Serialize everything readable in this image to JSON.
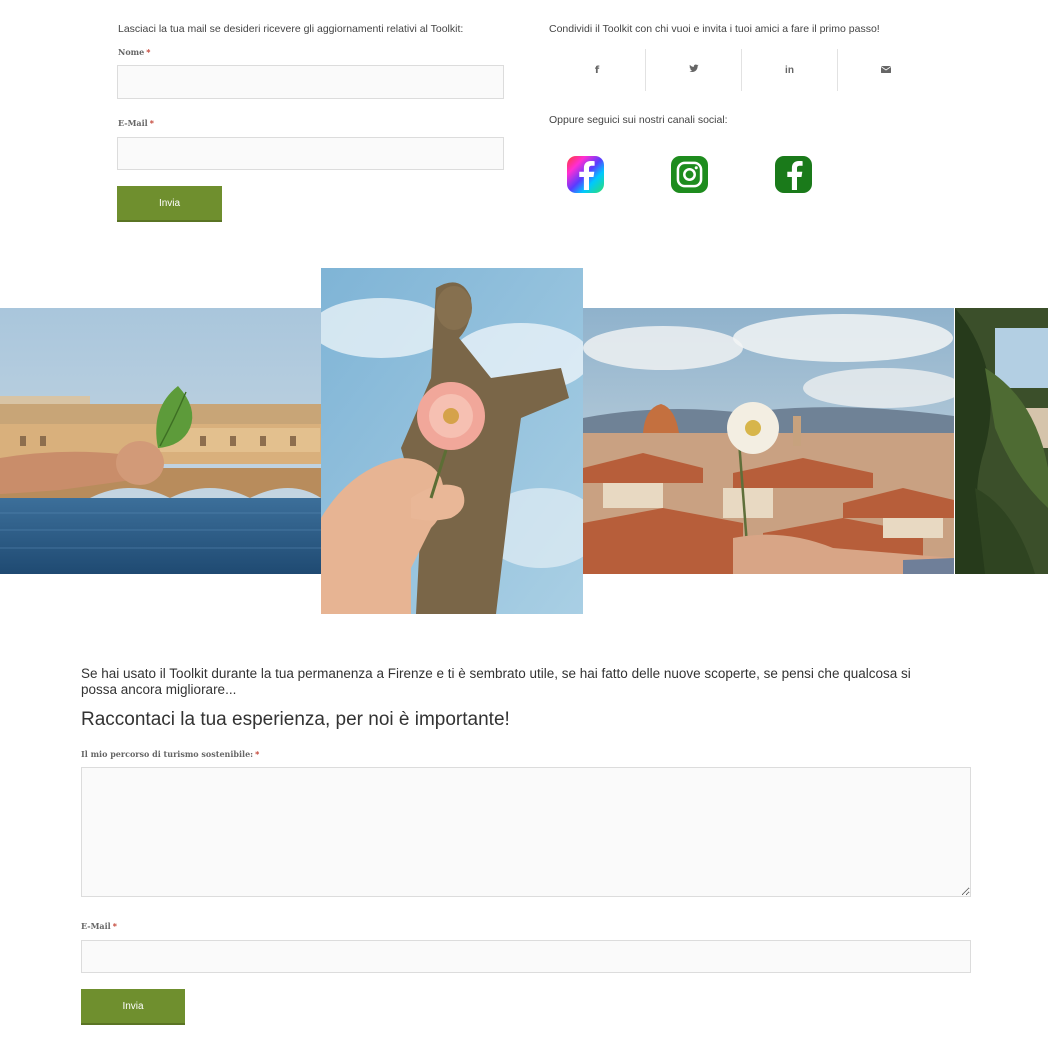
{
  "newsletter": {
    "intro": "Lasciaci la tua mail se desideri ricevere gli aggiornamenti relativi al Toolkit:",
    "name_label": "Nome",
    "email_label": "E-Mail",
    "required_mark": "*",
    "submit_label": "Invia"
  },
  "share": {
    "intro": "Condividi il Toolkit con chi vuoi e invita i tuoi amici a fare il primo passo!",
    "buttons": [
      {
        "icon": "facebook-icon",
        "glyph": "f"
      },
      {
        "icon": "twitter-icon",
        "glyph": "🐦"
      },
      {
        "icon": "linkedin-icon",
        "glyph": "in"
      },
      {
        "icon": "mail-icon",
        "glyph": "✉"
      }
    ],
    "follow_intro": "Oppure seguici sui nostri canali social:",
    "social_icons": [
      "facebook-gradient-icon",
      "instagram-icon",
      "facebook-icon"
    ]
  },
  "gallery": {
    "photos": [
      "ponte-vecchio-leaf",
      "statue-rose",
      "florence-rooftops-daisy",
      "leaves-partial"
    ]
  },
  "feedback": {
    "text": "Se hai usato il Toolkit durante la tua permanenza a Firenze e ti è sembrato utile, se hai fatto delle nuove scoperte, se pensi che qualcosa si possa ancora migliorare...",
    "heading": "Raccontaci la tua esperienza, per noi è importante!",
    "textarea_label": "Il mio percorso di turismo sostenibile:",
    "email_label": "E-Mail",
    "required_mark": "*",
    "submit_label": "Invia"
  },
  "colors": {
    "accent": "#6f8f2e",
    "instagram": "#1e8c1e",
    "facebook_dark": "#1a7a1a"
  }
}
